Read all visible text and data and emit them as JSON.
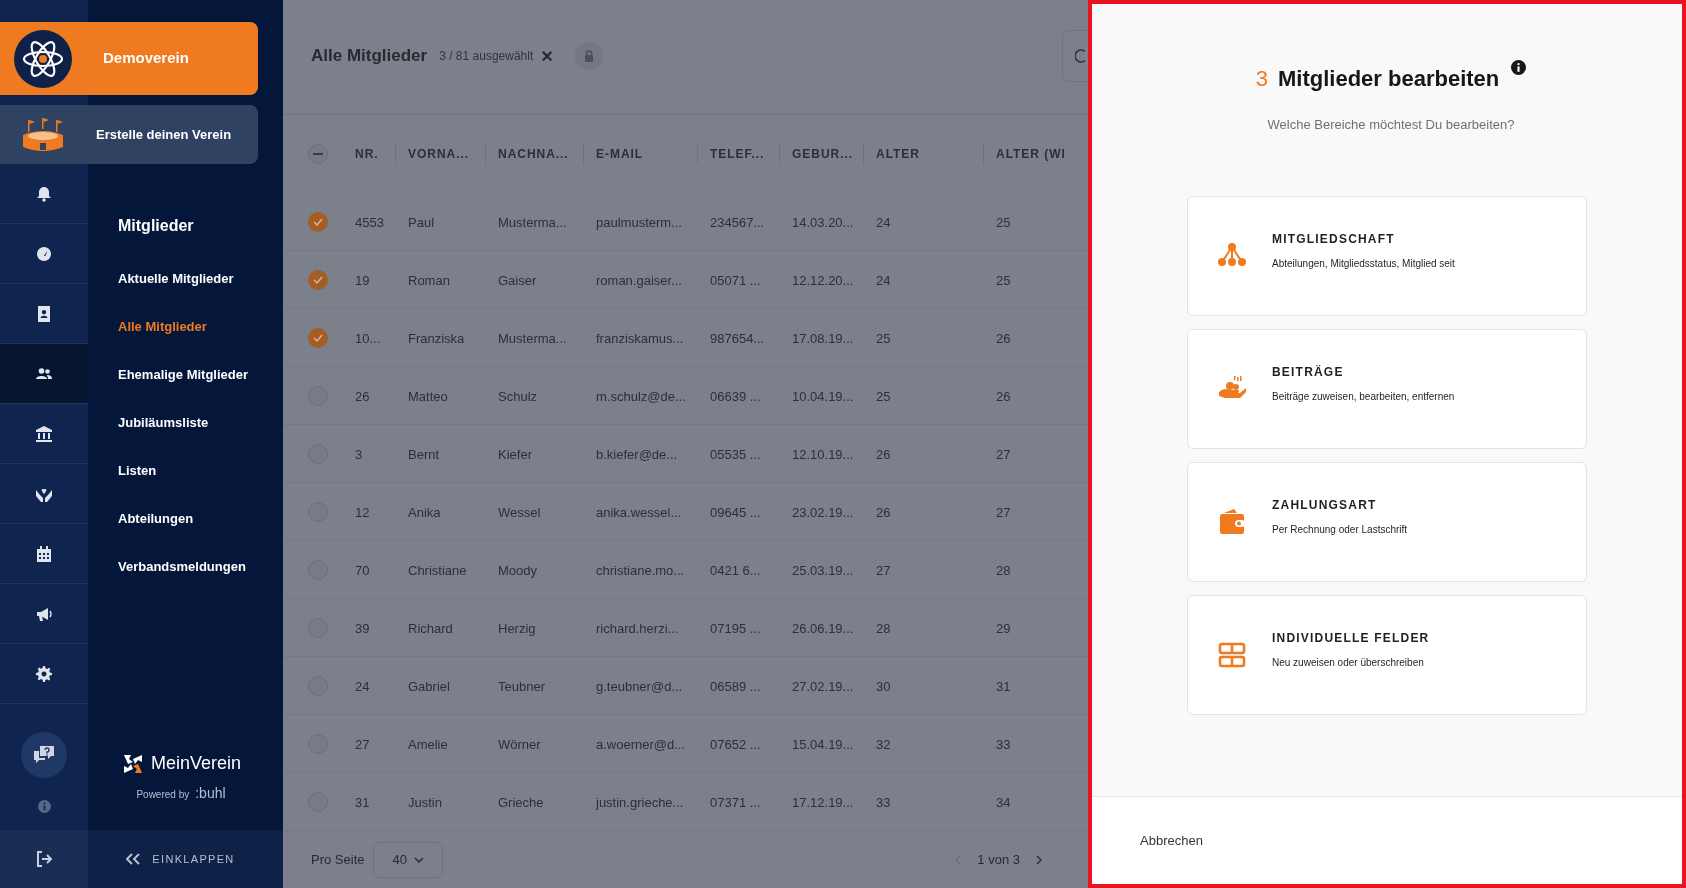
{
  "sidebar": {
    "club": {
      "name": "Demoverein"
    },
    "create_club": {
      "label": "Erstelle deinen Verein"
    },
    "rail": [
      {
        "kind": "bell",
        "selected": false
      },
      {
        "kind": "gauge",
        "selected": false
      },
      {
        "kind": "contact",
        "selected": false
      },
      {
        "kind": "members",
        "selected": true
      },
      {
        "kind": "bank",
        "selected": false
      },
      {
        "kind": "heart-hand",
        "selected": false
      },
      {
        "kind": "calendar",
        "selected": false
      },
      {
        "kind": "megaphone",
        "selected": false
      },
      {
        "kind": "gear",
        "selected": false
      }
    ],
    "section_title": "Mitglieder",
    "nav": [
      {
        "label": "Aktuelle Mitglieder",
        "selected": false
      },
      {
        "label": "Alle Mitglieder",
        "selected": true
      },
      {
        "label": "Ehemalige Mitglieder",
        "selected": false
      },
      {
        "label": "Jubiläumsliste",
        "selected": false
      },
      {
        "label": "Listen",
        "selected": false
      },
      {
        "label": "Abteilungen",
        "selected": false
      },
      {
        "label": "Verbandsmeldungen",
        "selected": false
      }
    ],
    "brand": {
      "name": "MeinVerein",
      "powered_by": "Powered by",
      "partner": ":buhl"
    },
    "collapse": "EINKLAPPEN"
  },
  "header": {
    "title": "Alle Mitglieder",
    "selection": "3 / 81 ausgewählt",
    "clear": "×"
  },
  "table": {
    "select_all_partial": true,
    "columns": [
      "NR.",
      "VORNA...",
      "NACHNA...",
      "E-MAIL",
      "TELEF...",
      "GEBUR...",
      "ALTER",
      "ALTER (WI"
    ],
    "rows": [
      {
        "selected": true,
        "cells": [
          "4553",
          "Paul",
          "Musterma...",
          "paulmusterm...",
          "234567...",
          "14.03.20...",
          "24",
          "25"
        ]
      },
      {
        "selected": true,
        "cells": [
          "19",
          "Roman",
          "Gaiser",
          "roman.gaiser...",
          "05071 ...",
          "12.12.20...",
          "24",
          "25"
        ]
      },
      {
        "selected": true,
        "cells": [
          "10...",
          "Franziska",
          "Musterma...",
          "franziskamus...",
          "987654...",
          "17.08.19...",
          "25",
          "26"
        ]
      },
      {
        "selected": false,
        "cells": [
          "26",
          "Matteo",
          "Schulz",
          "m.schulz@de...",
          "06639 ...",
          "10.04.19...",
          "25",
          "26"
        ]
      },
      {
        "selected": false,
        "cells": [
          "3",
          "Bernt",
          "Kiefer",
          "b.kiefer@de...",
          "05535 ...",
          "12.10.19...",
          "26",
          "27"
        ]
      },
      {
        "selected": false,
        "cells": [
          "12",
          "Anika",
          "Wessel",
          "anika.wessel...",
          "09645 ...",
          "23.02.19...",
          "26",
          "27"
        ]
      },
      {
        "selected": false,
        "cells": [
          "70",
          "Christiane",
          "Moody",
          "christiane.mo...",
          "0421 6...",
          "25.03.19...",
          "27",
          "28"
        ]
      },
      {
        "selected": false,
        "cells": [
          "39",
          "Richard",
          "Herzig",
          "richard.herzi...",
          "07195 ...",
          "26.06.19...",
          "28",
          "29"
        ]
      },
      {
        "selected": false,
        "cells": [
          "24",
          "Gabriel",
          "Teubner",
          "g.teubner@d...",
          "06589 ...",
          "27.02.19...",
          "30",
          "31"
        ]
      },
      {
        "selected": false,
        "cells": [
          "27",
          "Amelie",
          "Wörner",
          "a.woerner@d...",
          "07652 ...",
          "15.04.19...",
          "32",
          "33"
        ]
      },
      {
        "selected": false,
        "cells": [
          "31",
          "Justin",
          "Grieche",
          "justin.grieche...",
          "07371 ...",
          "17.12.19...",
          "33",
          "34"
        ]
      }
    ]
  },
  "pagination": {
    "per_page_label": "Pro Seite",
    "per_page": "40",
    "page": "1 von 3"
  },
  "modal": {
    "count": "3",
    "title": "Mitglieder bearbeiten",
    "subtitle": "Welche Bereiche möchtest Du bearbeiten?",
    "options": [
      {
        "kind": "membership",
        "title": "MITGLIEDSCHAFT",
        "description": "Abteilungen, Mitgliedsstatus, Mitglied seit"
      },
      {
        "kind": "fees",
        "title": "BEITRÄGE",
        "description": "Beiträge zuweisen, bearbeiten, entfernen"
      },
      {
        "kind": "payment",
        "title": "ZAHLUNGSART",
        "description": "Per Rechnung oder Lastschrift"
      },
      {
        "kind": "fields",
        "title": "INDIVIDUELLE FELDER",
        "description": "Neu zuweisen oder überschreiben"
      }
    ],
    "cancel": "Abbrechen"
  }
}
